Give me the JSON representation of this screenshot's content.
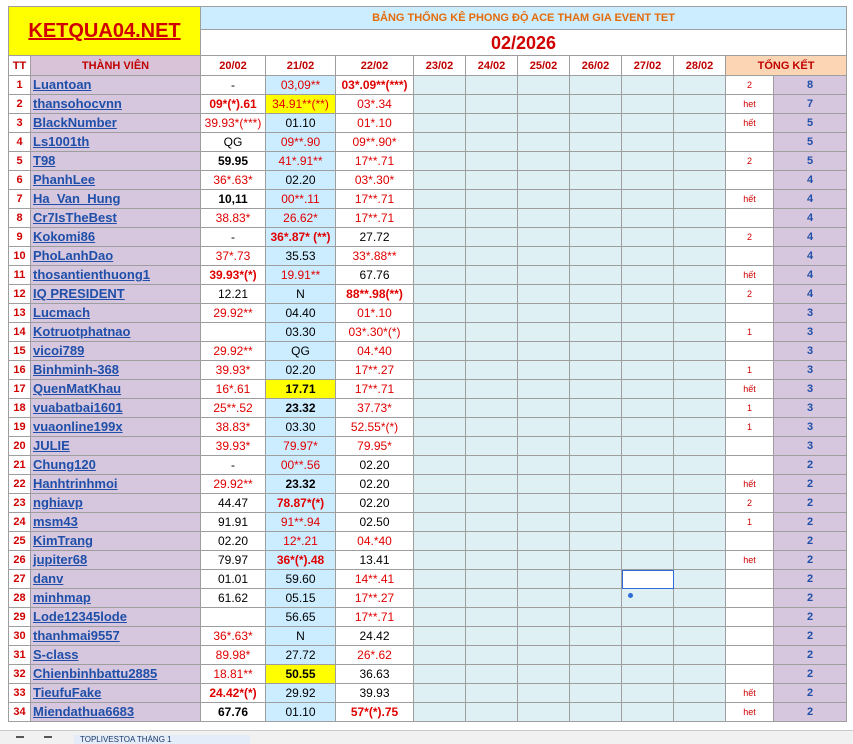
{
  "logo": "KETQUA04.NET",
  "subtitle": "BẢNG THỐNG KÊ PHONG ĐỘ ACE THAM GIA EVENT TET",
  "month": "02/2026",
  "headers": {
    "tt": "TT",
    "name": "THÀNH VIÊN",
    "dates": [
      "20/02",
      "21/02",
      "22/02",
      "23/02",
      "24/02",
      "25/02",
      "26/02",
      "27/02",
      "28/02"
    ],
    "total": "TỔNG KẾT"
  },
  "rows": [
    {
      "tt": "1",
      "name": "Luantoan",
      "v": [
        {
          "t": "-",
          "c": "blk"
        },
        {
          "t": "03,09**",
          "c": "red"
        },
        {
          "t": "03*.09**(***)",
          "c": "red",
          "b": true
        }
      ],
      "note": "2",
      "total": "8"
    },
    {
      "tt": "2",
      "name": "thansohocvnn",
      "v": [
        {
          "t": "09*(*).61",
          "c": "red",
          "b": true
        },
        {
          "t": "34.91**(**)",
          "c": "red",
          "y": true
        },
        {
          "t": "03*.34",
          "c": "red"
        }
      ],
      "note": "het",
      "total": "7"
    },
    {
      "tt": "3",
      "name": "BlackNumber",
      "v": [
        {
          "t": "39.93*(***)",
          "c": "red"
        },
        {
          "t": "01.10",
          "c": "blk"
        },
        {
          "t": "01*.10",
          "c": "red"
        }
      ],
      "note": "hết",
      "total": "5"
    },
    {
      "tt": "4",
      "name": "Ls1001th",
      "v": [
        {
          "t": "QG",
          "c": "blk"
        },
        {
          "t": "09**.90",
          "c": "red"
        },
        {
          "t": "09**.90*",
          "c": "red"
        }
      ],
      "note": "",
      "total": "5"
    },
    {
      "tt": "5",
      "name": "T98",
      "v": [
        {
          "t": "59.95",
          "c": "blk",
          "b": true
        },
        {
          "t": "41*.91**",
          "c": "red"
        },
        {
          "t": "17**.71",
          "c": "red"
        }
      ],
      "note": "2",
      "total": "5"
    },
    {
      "tt": "6",
      "name": "PhanhLee",
      "v": [
        {
          "t": "36*.63*",
          "c": "red"
        },
        {
          "t": "02.20",
          "c": "blk"
        },
        {
          "t": "03*.30*",
          "c": "red"
        }
      ],
      "note": "",
      "total": "4"
    },
    {
      "tt": "7",
      "name": "Ha_Van_Hung",
      "v": [
        {
          "t": "10,11",
          "c": "blk",
          "b": true
        },
        {
          "t": "00**.11",
          "c": "red"
        },
        {
          "t": "17**.71",
          "c": "red"
        }
      ],
      "note": "hết",
      "total": "4"
    },
    {
      "tt": "8",
      "name": "Cr7IsTheBest",
      "v": [
        {
          "t": "38.83*",
          "c": "red"
        },
        {
          "t": "26.62*",
          "c": "red"
        },
        {
          "t": "17**.71",
          "c": "red"
        }
      ],
      "note": "",
      "total": "4"
    },
    {
      "tt": "9",
      "name": "Kokomi86",
      "v": [
        {
          "t": "-",
          "c": "blk"
        },
        {
          "t": "36*.87* (**)",
          "c": "red",
          "b": true
        },
        {
          "t": "27.72",
          "c": "blk"
        }
      ],
      "note": "2",
      "total": "4"
    },
    {
      "tt": "10",
      "name": "PhoLanhDao",
      "v": [
        {
          "t": "37*.73",
          "c": "red"
        },
        {
          "t": "35.53",
          "c": "blk"
        },
        {
          "t": "33*.88**",
          "c": "red"
        }
      ],
      "note": "",
      "total": "4"
    },
    {
      "tt": "11",
      "name": "thosantienthuong1",
      "v": [
        {
          "t": "39.93*(*)",
          "c": "red",
          "b": true
        },
        {
          "t": "19.91**",
          "c": "red"
        },
        {
          "t": "67.76",
          "c": "blk"
        }
      ],
      "note": "hết",
      "total": "4"
    },
    {
      "tt": "12",
      "name": "IQ PRESIDENT",
      "v": [
        {
          "t": "12.21",
          "c": "blk"
        },
        {
          "t": "N",
          "c": "blk"
        },
        {
          "t": "88**.98(**)",
          "c": "red",
          "b": true
        }
      ],
      "note": "2",
      "total": "4"
    },
    {
      "tt": "13",
      "name": "Lucmach",
      "v": [
        {
          "t": "29.92**",
          "c": "red"
        },
        {
          "t": "04.40",
          "c": "blk"
        },
        {
          "t": "01*.10",
          "c": "red"
        }
      ],
      "note": "",
      "total": "3"
    },
    {
      "tt": "14",
      "name": "Kotruotphatnao",
      "v": [
        {
          "t": "",
          "c": "blk"
        },
        {
          "t": "03.30",
          "c": "blk"
        },
        {
          "t": "03*.30*(*)",
          "c": "red"
        }
      ],
      "note": "1",
      "total": "3"
    },
    {
      "tt": "15",
      "name": "vicoi789",
      "v": [
        {
          "t": "29.92**",
          "c": "red"
        },
        {
          "t": "QG",
          "c": "blk"
        },
        {
          "t": "04.*40",
          "c": "red"
        }
      ],
      "note": "",
      "total": "3"
    },
    {
      "tt": "16",
      "name": "Binhminh-368",
      "v": [
        {
          "t": "39.93*",
          "c": "red"
        },
        {
          "t": "02.20",
          "c": "blk"
        },
        {
          "t": "17**.27",
          "c": "red"
        }
      ],
      "note": "1",
      "total": "3"
    },
    {
      "tt": "17",
      "name": "QuenMatKhau",
      "v": [
        {
          "t": "16*.61",
          "c": "red"
        },
        {
          "t": "17.71",
          "c": "blk",
          "b": true,
          "y": true
        },
        {
          "t": "17**.71",
          "c": "red"
        }
      ],
      "note": "hết",
      "total": "3"
    },
    {
      "tt": "18",
      "name": "vuabatbai1601",
      "v": [
        {
          "t": "25**.52",
          "c": "red"
        },
        {
          "t": "23.32",
          "c": "blk",
          "b": true
        },
        {
          "t": "37.73*",
          "c": "red"
        }
      ],
      "note": "1",
      "total": "3"
    },
    {
      "tt": "19",
      "name": "vuaonline199x",
      "v": [
        {
          "t": "38.83*",
          "c": "red"
        },
        {
          "t": "03.30",
          "c": "blk"
        },
        {
          "t": "52.55*(*)",
          "c": "red"
        }
      ],
      "note": "1",
      "total": "3"
    },
    {
      "tt": "20",
      "name": "JULIE",
      "v": [
        {
          "t": "39.93*",
          "c": "red"
        },
        {
          "t": "79.97*",
          "c": "red"
        },
        {
          "t": "79.95*",
          "c": "red"
        }
      ],
      "note": "",
      "total": "3"
    },
    {
      "tt": "21",
      "name": "Chung120",
      "v": [
        {
          "t": "-",
          "c": "blk"
        },
        {
          "t": "00**.56",
          "c": "red"
        },
        {
          "t": "02.20",
          "c": "blk"
        }
      ],
      "note": "",
      "total": "2"
    },
    {
      "tt": "22",
      "name": "Hanhtrinhmoi",
      "v": [
        {
          "t": "29.92**",
          "c": "red"
        },
        {
          "t": "23.32",
          "c": "blk",
          "b": true
        },
        {
          "t": "02.20",
          "c": "blk"
        }
      ],
      "note": "hết",
      "total": "2"
    },
    {
      "tt": "23",
      "name": "nghiavp",
      "v": [
        {
          "t": "44.47",
          "c": "blk"
        },
        {
          "t": "78.87*(*)",
          "c": "red",
          "b": true
        },
        {
          "t": "02.20",
          "c": "blk"
        }
      ],
      "note": "2",
      "total": "2"
    },
    {
      "tt": "24",
      "name": "msm43",
      "v": [
        {
          "t": "91.91",
          "c": "blk"
        },
        {
          "t": "91**.94",
          "c": "red"
        },
        {
          "t": "02.50",
          "c": "blk"
        }
      ],
      "note": "1",
      "total": "2"
    },
    {
      "tt": "25",
      "name": "KimTrang",
      "v": [
        {
          "t": "02.20",
          "c": "blk"
        },
        {
          "t": "12*.21",
          "c": "red"
        },
        {
          "t": "04.*40",
          "c": "red"
        }
      ],
      "note": "",
      "total": "2"
    },
    {
      "tt": "26",
      "name": "jupiter68",
      "v": [
        {
          "t": "79.97",
          "c": "blk"
        },
        {
          "t": "36*(*).48",
          "c": "red",
          "b": true
        },
        {
          "t": "13.41",
          "c": "blk"
        }
      ],
      "note": "het",
      "total": "2"
    },
    {
      "tt": "27",
      "name": "danv",
      "v": [
        {
          "t": "01.01",
          "c": "blk"
        },
        {
          "t": "59.60",
          "c": "blk"
        },
        {
          "t": "14**.41",
          "c": "red"
        }
      ],
      "note": "",
      "total": "2"
    },
    {
      "tt": "28",
      "name": "minhmap",
      "v": [
        {
          "t": "61.62",
          "c": "blk"
        },
        {
          "t": "05.15",
          "c": "blk"
        },
        {
          "t": "17**.27",
          "c": "red"
        }
      ],
      "note": "",
      "total": "2"
    },
    {
      "tt": "29",
      "name": "Lode12345lode",
      "v": [
        {
          "t": "",
          "c": "blk"
        },
        {
          "t": "56.65",
          "c": "blk"
        },
        {
          "t": "17**.71",
          "c": "red"
        }
      ],
      "note": "",
      "total": "2"
    },
    {
      "tt": "30",
      "name": "thanhmai9557",
      "v": [
        {
          "t": "36*.63*",
          "c": "red"
        },
        {
          "t": "N",
          "c": "blk"
        },
        {
          "t": "24.42",
          "c": "blk"
        }
      ],
      "note": "",
      "total": "2"
    },
    {
      "tt": "31",
      "name": "S-class",
      "v": [
        {
          "t": "89.98*",
          "c": "red"
        },
        {
          "t": "27.72",
          "c": "blk"
        },
        {
          "t": "26*.62",
          "c": "red"
        }
      ],
      "note": "",
      "total": "2"
    },
    {
      "tt": "32",
      "name": "Chienbinhbattu2885",
      "v": [
        {
          "t": "18.81**",
          "c": "red"
        },
        {
          "t": "50.55",
          "c": "blk",
          "b": true,
          "y": true
        },
        {
          "t": "36.63",
          "c": "blk"
        }
      ],
      "note": "",
      "total": "2"
    },
    {
      "tt": "33",
      "name": "TieufuFake",
      "v": [
        {
          "t": "24.42*(*)",
          "c": "red",
          "b": true
        },
        {
          "t": "29.92",
          "c": "blk"
        },
        {
          "t": "39.93",
          "c": "blk"
        }
      ],
      "note": "hết",
      "total": "2"
    },
    {
      "tt": "34",
      "name": "Miendathua6683",
      "v": [
        {
          "t": "67.76",
          "c": "blk",
          "b": true
        },
        {
          "t": "01.10",
          "c": "blk"
        },
        {
          "t": "57*(*).75",
          "c": "red",
          "b": true
        }
      ],
      "note": "het",
      "total": "2"
    }
  ],
  "sheet_tab": "TOPLIVESTOA THÁNG 1"
}
